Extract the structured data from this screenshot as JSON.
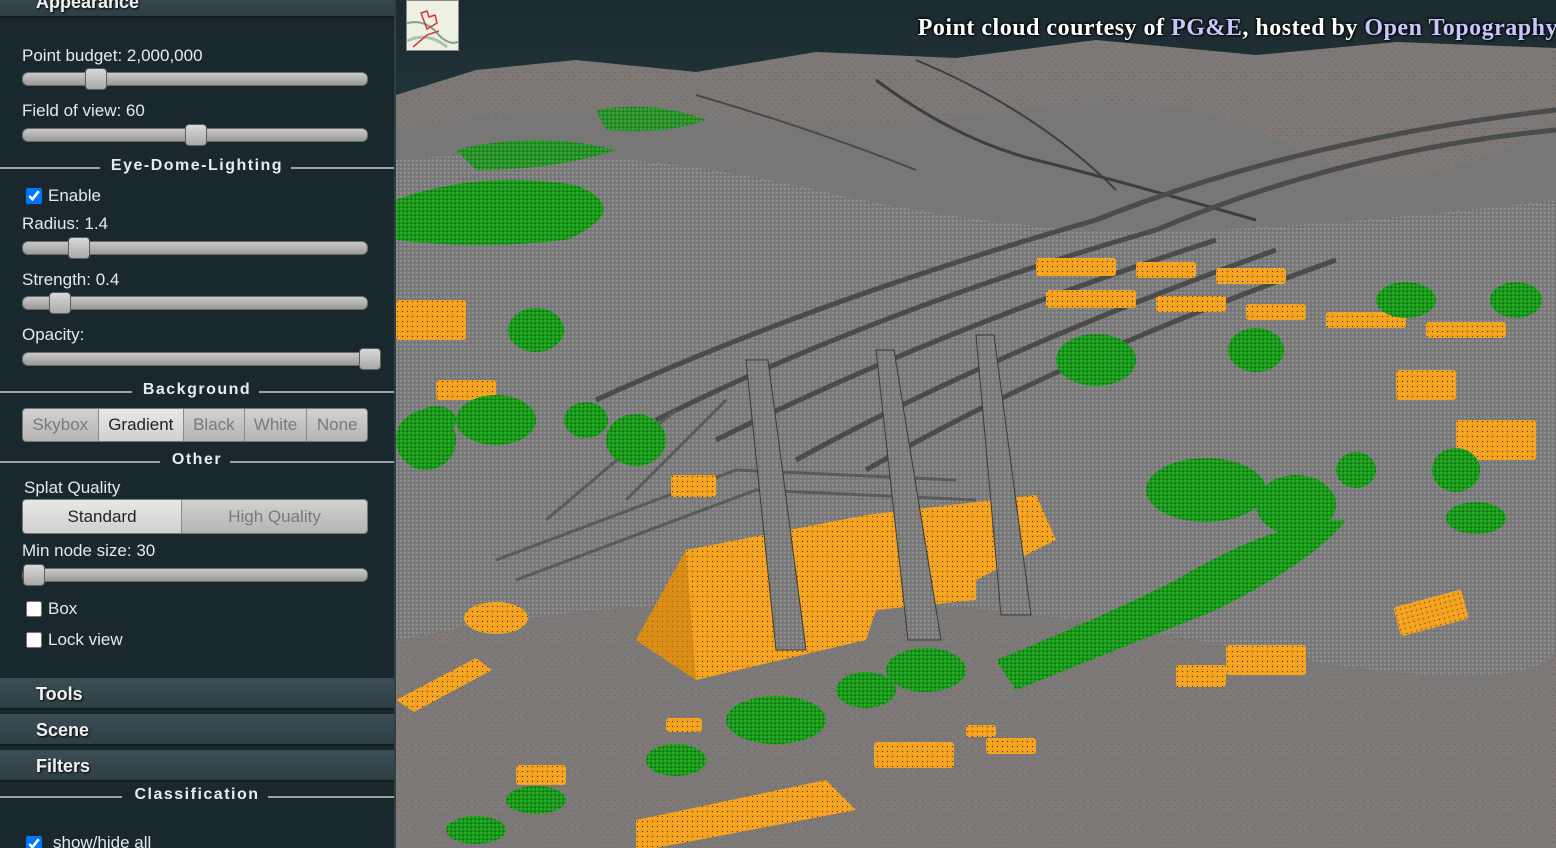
{
  "sidebar": {
    "appearance_header": "Appearance",
    "point_budget_label": "Point budget: 2,000,000",
    "field_of_view_label": "Field of view: 60",
    "edl": {
      "section_title": "Eye-Dome-Lighting",
      "enable_label": "Enable",
      "enable_checked": true,
      "radius_label": "Radius: 1.4",
      "strength_label": "Strength: 0.4",
      "opacity_label": "Opacity:"
    },
    "background": {
      "section_title": "Background",
      "options": [
        "Skybox",
        "Gradient",
        "Black",
        "White",
        "None"
      ],
      "selected": "Gradient"
    },
    "other": {
      "section_title": "Other",
      "splat_quality_label": "Splat Quality",
      "splat_options": [
        "Standard",
        "High Quality"
      ],
      "splat_selected": "Standard",
      "min_node_size_label": "Min node size: 30",
      "box_label": "Box",
      "box_checked": false,
      "lock_view_label": "Lock view",
      "lock_view_checked": false
    },
    "tools_header": "Tools",
    "scene_header": "Scene",
    "filters_header": "Filters",
    "classification": {
      "section_title": "Classification",
      "show_hide_all_label": "show/hide all",
      "show_hide_all_checked": true
    },
    "slider_levels": {
      "point_budget": 0.19,
      "field_of_view": 0.5,
      "edl_radius": 0.14,
      "edl_strength": 0.08,
      "edl_opacity": 1.0,
      "min_node_size": 0.0
    }
  },
  "viewport": {
    "attribution_prefix": "Point cloud courtesy of ",
    "attribution_link1": "PG&E",
    "attribution_middle": ", hosted by ",
    "attribution_link2": "Open Topography",
    "minimap_icon": "map-thumbnail-icon",
    "colors": {
      "ground": "#7d7d7d",
      "vegetation": "#1e9a1e",
      "building": "#f5a623",
      "soil": "#a0583a"
    }
  }
}
